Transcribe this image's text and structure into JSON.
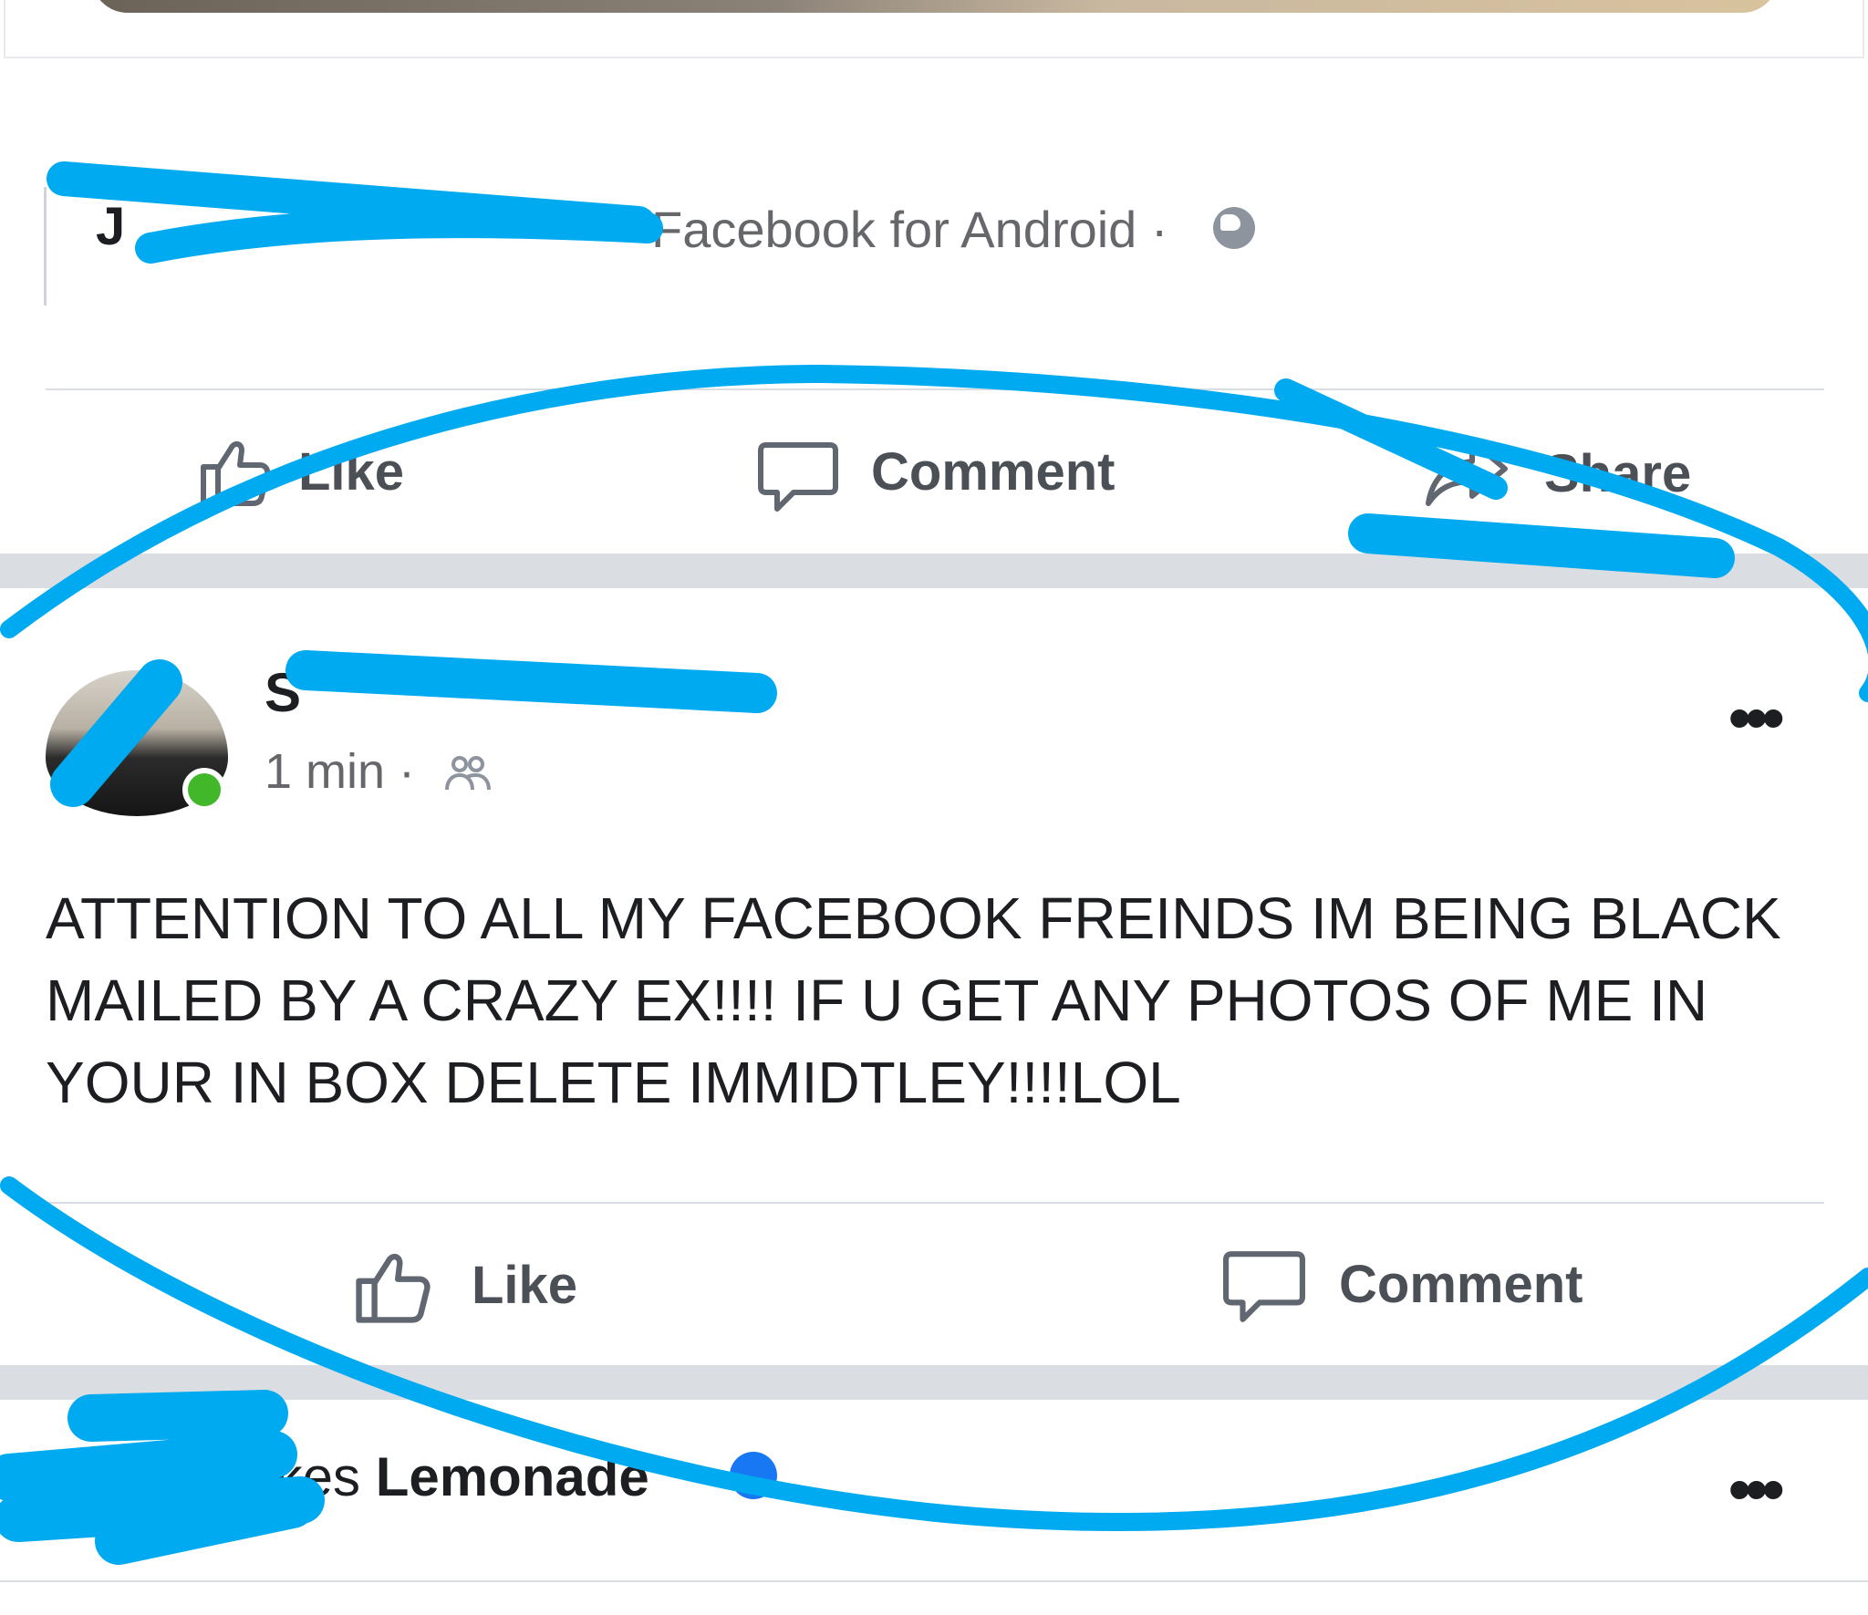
{
  "shared_post": {
    "author_visible": "J",
    "source": "Facebook for Android ·",
    "privacy_icon": "globe-icon"
  },
  "shared_actions": {
    "like": "Like",
    "comment": "Comment",
    "share": "Share"
  },
  "post": {
    "author_visible": "S",
    "time": "1 min ·",
    "audience_icon": "friends-icon",
    "more": "•••",
    "text": "ATTENTION TO ALL MY FACEBOOK FREINDS IM BEING BLACK MAILED BY A CRAZY EX!!!! IF U GET ANY PHOTOS OF ME IN YOUR IN BOX DELETE IMMIDTLEY!!!!LOL"
  },
  "post_actions": {
    "like": "Like",
    "comment": "Comment"
  },
  "next_story": {
    "verb": "likes",
    "page": "Lemonade",
    "more": "•••"
  },
  "colors": {
    "annotation": "#00aaf0",
    "divider": "#dadde1",
    "online": "#42b72a",
    "secondary_text": "#65676b"
  }
}
